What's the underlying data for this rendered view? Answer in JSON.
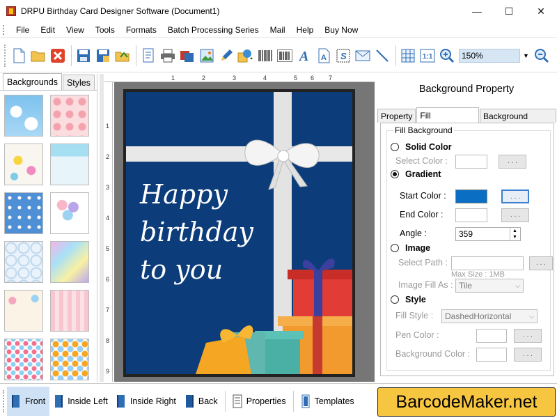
{
  "window": {
    "title": "DRPU Birthday Card Designer Software (Document1)",
    "minimize": "—",
    "maximize": "☐",
    "close": "✕"
  },
  "menu": [
    "File",
    "Edit",
    "View",
    "Tools",
    "Formats",
    "Batch Processing Series",
    "Mail",
    "Help",
    "Buy Now"
  ],
  "toolbar": {
    "zoom_value": "150%"
  },
  "left_panel": {
    "tabs": [
      "Backgrounds",
      "Styles"
    ]
  },
  "ruler": {
    "h_numbers": [
      "1",
      "2",
      "3",
      "4",
      "5",
      "6",
      "7"
    ],
    "v_numbers": [
      "1",
      "2",
      "3",
      "4",
      "5",
      "6",
      "7",
      "8",
      "9"
    ]
  },
  "card": {
    "line1": "Happy",
    "line2": "birthday",
    "line3": "to you"
  },
  "properties": {
    "title": "Background Property",
    "tabs": [
      "Property",
      "Fill Background",
      "Background Effects"
    ],
    "group_label": "Fill Background",
    "solid_color": "Solid Color",
    "select_color": "Select Color :",
    "gradient": "Gradient",
    "start_color": "Start Color :",
    "end_color": "End Color :",
    "angle": "Angle :",
    "angle_value": "359",
    "image": "Image",
    "select_path": "Select Path :",
    "max_size": "Max Size : 1MB",
    "image_fill_as": "Image Fill As :",
    "image_fill_value": "Tile",
    "style": "Style",
    "fill_style": "Fill Style :",
    "fill_style_value": "DashedHorizontal",
    "pen_color": "Pen Color :",
    "background_color": "Background Color :",
    "dots": ". . .",
    "start_color_hex": "#0a6fc2"
  },
  "bottom": {
    "buttons": [
      "Front",
      "Inside Left",
      "Inside Right",
      "Back",
      "Properties",
      "Templates"
    ]
  },
  "logo": "BarcodeMaker.net"
}
